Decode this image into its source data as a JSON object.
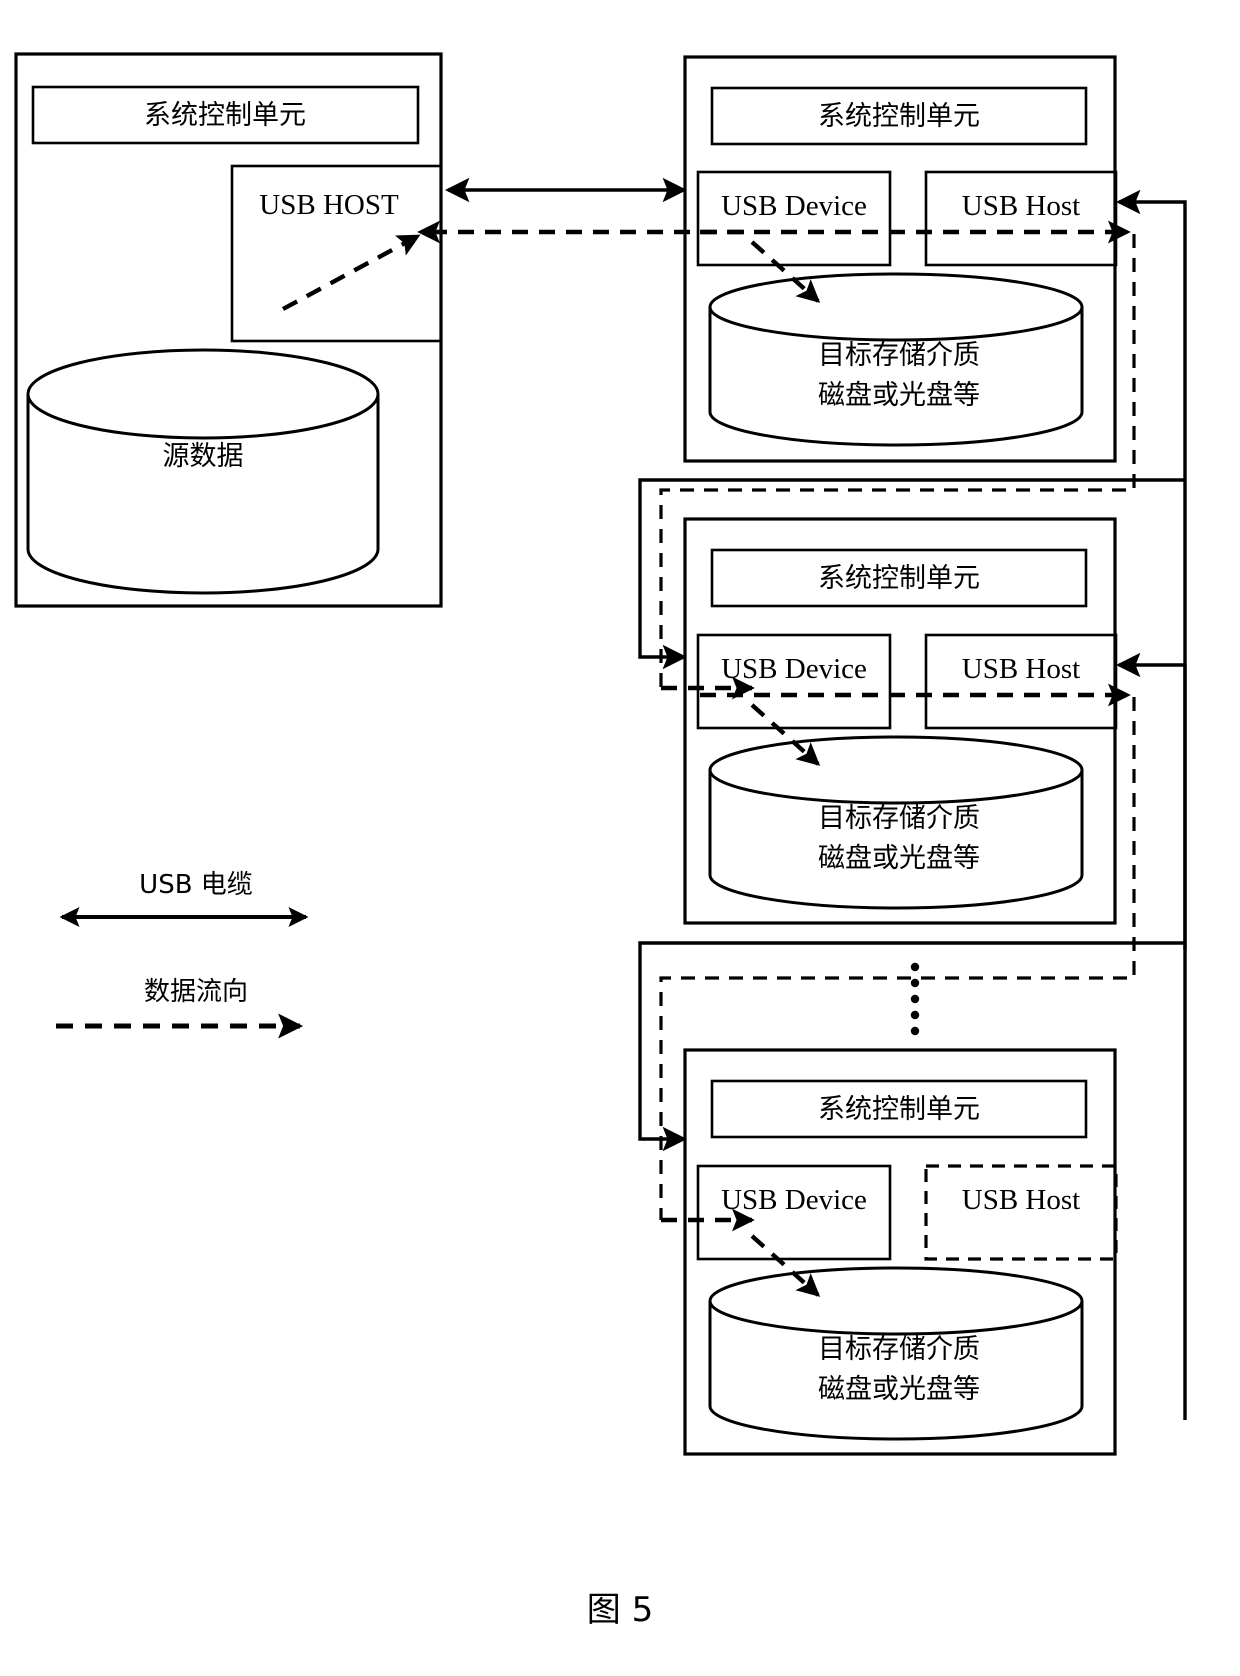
{
  "figure": {
    "caption": "图 5",
    "caption_number": "5"
  },
  "source_panel": {
    "name": "source-device",
    "control_unit_label": "系统控制单元",
    "usb_host_label": "USB HOST",
    "storage_label": "源数据"
  },
  "target_panels": [
    {
      "name": "target-device-1",
      "control_unit_label": "系统控制单元",
      "usb_device_label": "USB Device",
      "usb_host_label": "USB Host",
      "usb_host_dashed": false,
      "storage_line1": "目标存储介质",
      "storage_line2": "磁盘或光盘等"
    },
    {
      "name": "target-device-2",
      "control_unit_label": "系统控制单元",
      "usb_device_label": "USB Device",
      "usb_host_label": "USB Host",
      "usb_host_dashed": false,
      "storage_line1": "目标存储介质",
      "storage_line2": "磁盘或光盘等"
    },
    {
      "name": "target-device-n",
      "control_unit_label": "系统控制单元",
      "usb_device_label": "USB Device",
      "usb_host_label": "USB Host",
      "usb_host_dashed": true,
      "storage_line1": "目标存储介质",
      "storage_line2": "磁盘或光盘等"
    }
  ],
  "legend": {
    "items": [
      {
        "name": "usb-cable",
        "label": "USB 电缆",
        "style": "solid-double-arrow"
      },
      {
        "name": "data-flow",
        "label": "数据流向",
        "style": "dashed-single-arrow"
      }
    ]
  },
  "ellipsis": {
    "label": "⋮",
    "dot_count": 5
  },
  "colors": {
    "stroke": "#000000",
    "background": "#ffffff",
    "text": "#000000"
  }
}
